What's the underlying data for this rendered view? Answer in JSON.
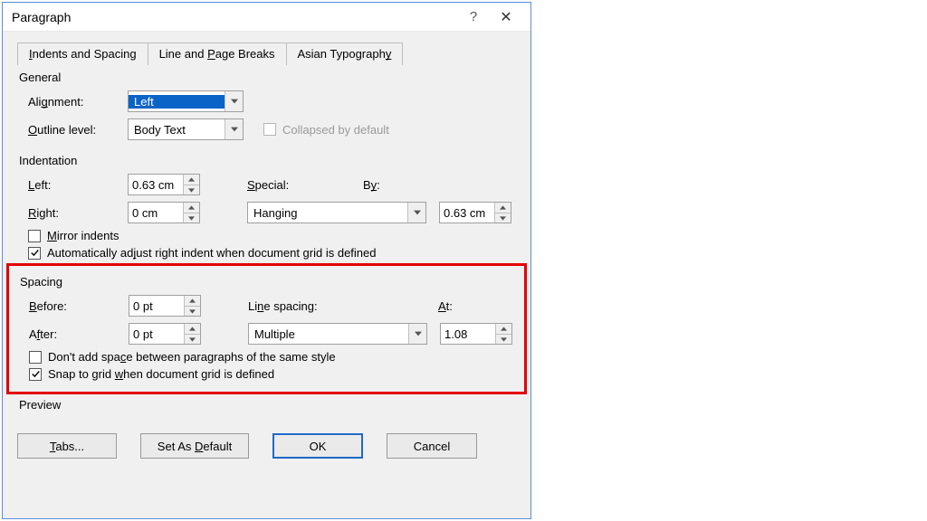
{
  "title": "Paragraph",
  "tabs": [
    "Indents and Spacing",
    "Line and Page Breaks",
    "Asian Typography"
  ],
  "general": {
    "title": "General",
    "alignment_label_pre": "Ali",
    "alignment_label_u": "g",
    "alignment_label_post": "nment:",
    "alignment_value": "Left",
    "outline_label_u": "O",
    "outline_label_post": "utline level:",
    "outline_value": "Body Text",
    "collapsed_label": "Collapsed by default"
  },
  "indent": {
    "title": "Indentation",
    "left_u": "L",
    "left_post": "eft:",
    "left_value": "0.63 cm",
    "right_u": "R",
    "right_post": "ight:",
    "right_value": "0 cm",
    "special_u": "S",
    "special_post": "pecial:",
    "special_value": "Hanging",
    "by_label": "By:",
    "by_u": "y",
    "by_value": "0.63 cm",
    "mirror_u": "M",
    "mirror_post": "irror indents",
    "auto_pre": "Automatically ad",
    "auto_u": "j",
    "auto_post": "ust right indent when document grid is defined"
  },
  "spacing": {
    "title": "Spacing",
    "before_u": "B",
    "before_post": "efore:",
    "before_value": "0 pt",
    "after_pre": "A",
    "after_u": "f",
    "after_post": "ter:",
    "after_value": "0 pt",
    "line_label_pre": "Li",
    "line_label_u": "n",
    "line_label_post": "e spacing:",
    "line_value": "Multiple",
    "at_u": "A",
    "at_post": "t:",
    "at_value": "1.08",
    "dontadd_pre": "Don't add spa",
    "dontadd_u": "c",
    "dontadd_post": "e between paragraphs of the same style",
    "snap_pre": "Snap to grid ",
    "snap_u": "w",
    "snap_post": "hen document grid is defined"
  },
  "preview_title": "Preview",
  "buttons": {
    "tabs_u": "T",
    "tabs_post": "abs...",
    "default_pre": "Set As ",
    "default_u": "D",
    "default_post": "efault",
    "ok": "OK",
    "cancel": "Cancel"
  }
}
